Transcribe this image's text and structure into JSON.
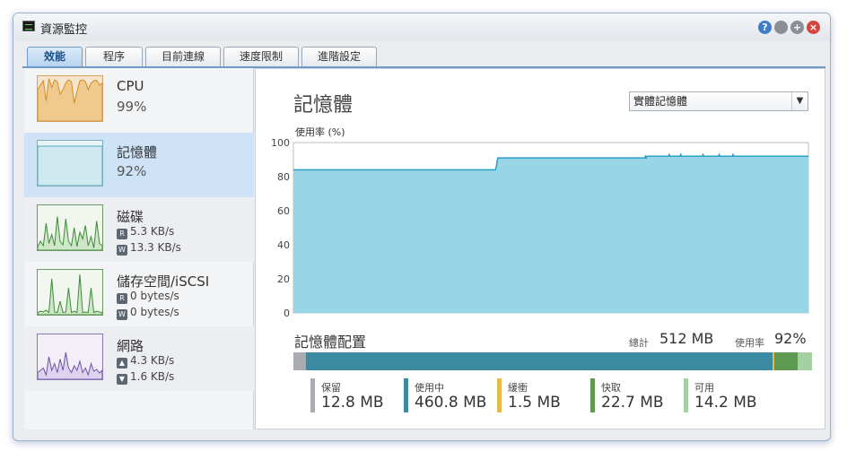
{
  "window": {
    "title": "資源監控",
    "buttons": [
      "?",
      "",
      "+",
      "×"
    ]
  },
  "tabs": [
    {
      "label": "效能",
      "active": true
    },
    {
      "label": "程序",
      "active": false
    },
    {
      "label": "目前連線",
      "active": false
    },
    {
      "label": "速度限制",
      "active": false
    },
    {
      "label": "進階設定",
      "active": false
    }
  ],
  "sidebar": {
    "items": [
      {
        "name": "CPU",
        "value": "99%"
      },
      {
        "name": "記憶體",
        "value": "92%"
      },
      {
        "name": "磁碟",
        "read": "5.3 KB/s",
        "write": "13.3 KB/s",
        "read_badge": "R",
        "write_badge": "W"
      },
      {
        "name": "儲存空間/iSCSI",
        "read": "0 bytes/s",
        "write": "0 bytes/s",
        "read_badge": "R",
        "write_badge": "W"
      },
      {
        "name": "網路",
        "up": "4.3 KB/s",
        "down": "1.6 KB/s"
      }
    ]
  },
  "main": {
    "title": "記憶體",
    "select_value": "實體記憶體",
    "usage_label": "使用率 (%)",
    "allocation_title": "記憶體配置",
    "total_label": "總計",
    "total_value": "512 MB",
    "rate_label": "使用率",
    "rate_value": "92%",
    "legend": [
      {
        "name": "保留",
        "value": "12.8 MB",
        "color": "#a8abb0",
        "mb": 12.8
      },
      {
        "name": "使用中",
        "value": "460.8 MB",
        "color": "#3a8aa2",
        "mb": 460.8
      },
      {
        "name": "緩衝",
        "value": "1.5 MB",
        "color": "#e7b84a",
        "mb": 1.5
      },
      {
        "name": "快取",
        "value": "22.7 MB",
        "color": "#5f9a52",
        "mb": 22.7
      },
      {
        "name": "可用",
        "value": "14.2 MB",
        "color": "#a5d0a2",
        "mb": 14.2
      }
    ]
  },
  "chart_data": {
    "type": "area",
    "title": "",
    "ylabel": "使用率 (%)",
    "ylim": [
      0,
      100
    ],
    "yticks": [
      0,
      20,
      40,
      60,
      80,
      100
    ],
    "grid": true,
    "fill_color": "#98d5e7",
    "line_color": "#2aa0c6",
    "values": [
      84,
      84,
      84,
      84,
      84,
      84,
      84,
      84,
      84,
      84,
      84,
      84,
      84,
      84,
      84,
      84,
      84,
      84,
      84,
      84,
      84,
      84,
      84,
      84,
      84,
      84,
      84,
      84,
      84,
      84,
      84,
      84,
      84,
      84,
      84,
      84,
      84,
      84,
      84,
      84,
      84,
      84,
      84,
      84,
      84,
      84,
      84,
      84,
      84,
      84,
      84,
      84,
      84,
      84,
      84,
      84,
      84,
      84,
      84,
      84,
      84,
      84,
      84,
      84,
      84,
      84,
      84,
      84,
      84,
      84,
      84,
      84,
      84,
      84,
      84,
      84,
      84,
      84,
      84,
      84,
      84,
      84,
      84,
      84,
      84,
      84,
      84,
      84,
      84,
      84,
      84,
      84,
      84,
      84,
      84,
      84,
      84,
      84,
      84,
      84,
      84,
      84,
      84,
      84,
      84,
      84,
      84,
      84,
      84,
      84,
      84,
      84,
      84,
      84,
      84,
      84,
      84,
      84,
      84,
      84,
      84,
      84,
      84,
      84,
      84,
      84,
      84,
      84,
      84,
      84,
      84,
      84,
      84,
      84,
      84,
      84,
      84,
      84,
      84,
      84,
      84,
      84,
      84,
      84,
      84,
      84,
      84,
      84,
      84,
      84,
      84,
      84,
      84,
      84,
      84,
      84,
      84,
      84,
      84,
      84,
      84,
      84,
      84,
      84,
      84,
      84,
      84,
      84,
      84,
      84,
      84,
      84,
      84,
      84,
      84,
      84,
      84,
      84,
      84,
      84,
      84,
      84,
      84,
      84,
      84,
      84,
      84,
      84,
      84,
      84,
      84,
      84,
      84,
      84,
      84,
      84,
      84,
      84,
      84,
      84,
      84,
      84,
      84,
      84,
      84,
      84,
      84,
      84,
      84,
      84,
      84,
      84,
      84,
      84,
      84,
      84,
      84,
      84,
      84,
      84,
      84,
      84,
      84,
      84,
      84,
      84,
      84,
      84,
      84,
      84,
      84,
      84,
      84,
      84,
      84,
      84,
      84,
      84,
      84,
      84,
      84,
      84,
      84,
      84,
      84,
      84,
      84,
      84,
      84,
      84,
      84,
      84,
      84,
      84,
      84,
      84,
      84,
      84,
      84,
      84,
      84,
      84,
      84,
      84,
      86,
      89,
      91,
      91,
      91,
      91,
      91,
      91,
      91,
      91,
      91,
      91,
      91,
      91,
      91,
      91,
      91,
      91,
      91,
      91,
      91,
      91,
      91,
      91,
      91,
      91,
      91,
      91,
      91,
      91,
      91,
      91,
      91,
      91,
      91,
      91,
      91,
      91,
      91,
      91,
      91,
      91,
      91,
      91,
      91,
      91,
      91,
      91,
      91,
      91,
      91,
      91,
      91,
      91,
      91,
      91,
      91,
      91,
      91,
      91,
      91,
      91,
      91,
      91,
      91,
      91,
      91,
      91,
      91,
      91,
      91,
      91,
      91,
      91,
      91,
      91,
      91,
      91,
      91,
      91,
      91,
      91,
      91,
      91,
      91,
      91,
      91,
      91,
      91,
      91,
      91,
      91,
      91,
      91,
      91,
      91,
      91,
      91,
      91,
      91,
      91,
      91,
      91,
      91,
      91,
      91,
      91,
      91,
      91,
      91,
      91,
      91,
      91,
      91,
      91,
      91,
      91,
      91,
      91,
      91,
      91,
      91,
      91,
      91,
      91,
      91,
      91,
      91,
      91,
      91,
      91,
      91,
      91,
      91,
      91,
      91,
      91,
      91,
      91,
      91,
      91,
      91,
      91,
      91,
      91,
      91,
      91,
      91,
      91,
      91,
      91,
      91,
      91,
      91,
      91,
      91,
      91,
      91,
      91,
      91,
      91,
      91,
      91,
      91,
      91,
      91,
      91,
      91,
      91,
      91,
      91,
      91,
      91,
      91,
      91,
      91,
      91,
      91,
      91,
      91,
      91,
      91,
      91,
      91,
      91,
      91,
      91,
      91,
      91,
      91,
      91,
      91,
      91,
      91,
      92,
      91,
      92,
      92,
      92,
      92,
      92,
      92,
      92,
      92,
      92,
      92,
      92,
      92,
      92,
      92,
      92,
      92,
      92,
      92,
      92,
      92,
      92,
      92,
      92,
      92,
      92,
      92,
      92,
      92,
      92,
      93,
      92,
      92,
      92,
      92,
      92,
      92,
      92,
      92,
      92,
      92,
      92,
      92,
      92,
      92,
      93,
      92,
      92,
      92,
      92,
      92,
      92,
      92,
      92,
      92,
      92,
      92,
      92,
      92,
      92,
      92,
      92,
      92,
      92,
      92,
      92,
      92,
      92,
      92,
      92,
      92,
      92,
      92,
      92,
      93,
      92,
      92,
      92,
      92,
      92,
      92,
      92,
      92,
      92,
      92,
      92,
      92,
      92,
      92,
      92,
      92,
      92,
      92,
      92,
      92,
      93,
      92,
      92,
      92,
      92,
      92,
      92,
      92,
      92,
      92,
      92,
      92,
      92,
      92,
      92,
      92,
      92,
      92,
      93,
      92,
      92,
      92,
      92,
      92,
      92,
      92,
      92,
      92,
      92,
      92,
      92,
      92,
      92,
      92,
      92,
      92,
      92,
      92,
      92,
      92,
      92,
      92,
      92,
      92,
      92,
      92,
      92,
      92,
      92,
      92,
      92,
      92,
      92,
      92,
      92,
      92,
      92,
      92,
      92,
      92,
      92,
      92,
      92,
      92,
      92,
      92,
      92,
      92,
      92,
      92,
      92,
      92,
      92,
      92,
      92,
      92,
      92,
      92,
      92,
      92,
      92,
      92,
      92,
      92,
      92,
      92,
      92,
      92,
      92,
      92,
      92,
      92,
      92,
      92,
      92,
      92,
      92,
      92,
      92,
      92,
      92,
      92,
      92,
      92,
      92,
      92,
      92,
      92,
      92,
      92,
      92,
      92,
      92,
      92,
      92,
      92,
      92
    ]
  },
  "sparklines": {
    "cpu": [
      30,
      20,
      10,
      55,
      5,
      25,
      8,
      12,
      40,
      30,
      15,
      8,
      12,
      60,
      35,
      10,
      8,
      12,
      30,
      15,
      10,
      9,
      20,
      15
    ],
    "memory": [
      88,
      88,
      88,
      88,
      88,
      88,
      88,
      88,
      88,
      88,
      88,
      88,
      88,
      88,
      88,
      88,
      88,
      88,
      88,
      88,
      88,
      88,
      88,
      88
    ],
    "disk": [
      8,
      20,
      10,
      60,
      15,
      35,
      10,
      75,
      20,
      12,
      70,
      20,
      10,
      50,
      8,
      40,
      25,
      55,
      10,
      30,
      5,
      65,
      15,
      10
    ],
    "storage": [
      5,
      8,
      6,
      10,
      5,
      80,
      6,
      5,
      30,
      5,
      6,
      60,
      5,
      8,
      5,
      90,
      5,
      6,
      5,
      60,
      5,
      8,
      6,
      5
    ],
    "network": [
      15,
      20,
      25,
      10,
      50,
      20,
      35,
      15,
      45,
      20,
      60,
      25,
      15,
      30,
      20,
      40,
      15,
      25,
      10,
      35,
      18,
      22,
      14,
      20
    ]
  }
}
